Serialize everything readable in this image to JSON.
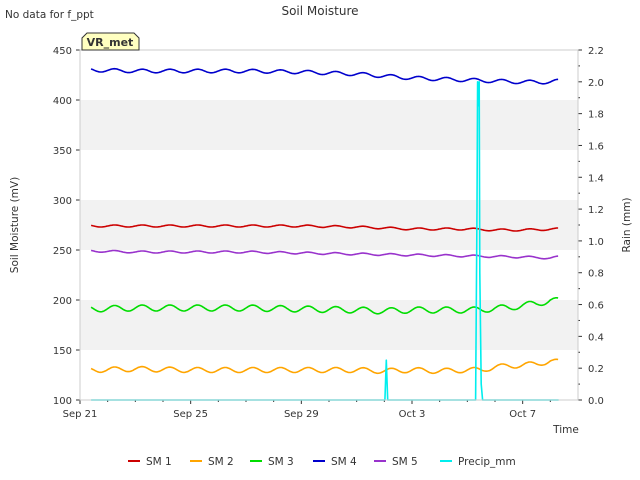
{
  "chart_data": {
    "type": "line",
    "title": "Soil Moisture",
    "note": "No data for f_ppt",
    "station_label": "VR_met",
    "xlabel": "Time",
    "ylabel": "Soil Moisture (mV)",
    "y2label": "Rain (mm)",
    "x_range": [
      0,
      18
    ],
    "x_ticks": [
      {
        "x": 0,
        "label": "Sep 21"
      },
      {
        "x": 4,
        "label": "Sep 25"
      },
      {
        "x": 8,
        "label": "Sep 29"
      },
      {
        "x": 12,
        "label": "Oct 3"
      },
      {
        "x": 16,
        "label": "Oct 7"
      }
    ],
    "ylim": [
      100,
      450
    ],
    "y_ticks": [
      100,
      150,
      200,
      250,
      300,
      350,
      400,
      450
    ],
    "y2lim": [
      0,
      2.2
    ],
    "y2_ticks": [
      "0.0",
      "0.2",
      "0.4",
      "0.6",
      "0.8",
      "1.0",
      "1.2",
      "1.4",
      "1.6",
      "1.8",
      "2.0",
      "2.2"
    ],
    "grid": "horizontal bands",
    "legend_position": "bottom",
    "series": [
      {
        "name": "SM 1",
        "color": "#cc0000",
        "axis": "left",
        "x": [
          0.4,
          2,
          4,
          6,
          8,
          10,
          11,
          12,
          13,
          14,
          15,
          16,
          17.3
        ],
        "values": [
          274,
          274,
          274,
          274,
          274,
          273,
          272,
          271,
          271,
          271,
          270,
          270,
          271
        ],
        "osc": 1.0,
        "period": 1
      },
      {
        "name": "SM 2",
        "color": "#ffa500",
        "axis": "left",
        "x": [
          0.4,
          2,
          4,
          6,
          8,
          10,
          11,
          12,
          13,
          14,
          14.5,
          15,
          15.5,
          16,
          16.5,
          17,
          17.3
        ],
        "values": [
          130,
          131,
          130,
          130,
          130,
          130,
          129,
          130,
          129,
          130,
          130,
          133,
          134,
          135,
          136,
          139,
          138
        ],
        "osc": 2.5,
        "period": 1
      },
      {
        "name": "SM 3",
        "color": "#00dd00",
        "axis": "left",
        "x": [
          0.4,
          2,
          4,
          6,
          8,
          10,
          11,
          12,
          13,
          14,
          14.5,
          15,
          15.5,
          16,
          16.5,
          17,
          17.3
        ],
        "values": [
          191,
          192,
          192,
          192,
          191,
          190,
          189,
          190,
          190,
          190,
          190,
          192,
          192,
          195,
          196,
          200,
          199
        ],
        "osc": 3.0,
        "period": 1
      },
      {
        "name": "SM 4",
        "color": "#0000cc",
        "axis": "left",
        "x": [
          0.4,
          2,
          4,
          6,
          8,
          9,
          10,
          11,
          12,
          13,
          14,
          15,
          16,
          17,
          17.3
        ],
        "values": [
          430,
          429,
          429,
          429,
          428,
          427,
          426,
          424,
          422,
          421,
          420,
          419,
          418,
          418,
          419
        ],
        "osc": 1.8,
        "period": 1
      },
      {
        "name": "SM 5",
        "color": "#9933cc",
        "axis": "left",
        "x": [
          0.4,
          2,
          4,
          6,
          8,
          10,
          12,
          14,
          16,
          17,
          17.3
        ],
        "values": [
          249,
          248,
          248,
          248,
          247,
          246,
          245,
          244,
          243,
          242,
          243
        ],
        "osc": 1.0,
        "period": 1
      },
      {
        "name": "Precip_mm",
        "color": "#00eeee",
        "axis": "right",
        "x": [
          0.4,
          11.02,
          11.07,
          11.12,
          11.17,
          14.3,
          14.35,
          14.37,
          14.4,
          14.43,
          14.45,
          14.5,
          14.55,
          17.3
        ],
        "values": [
          0,
          0,
          0.25,
          0,
          0,
          0,
          1.2,
          2.0,
          1.85,
          2.0,
          0.8,
          0.1,
          0,
          0
        ]
      }
    ]
  }
}
